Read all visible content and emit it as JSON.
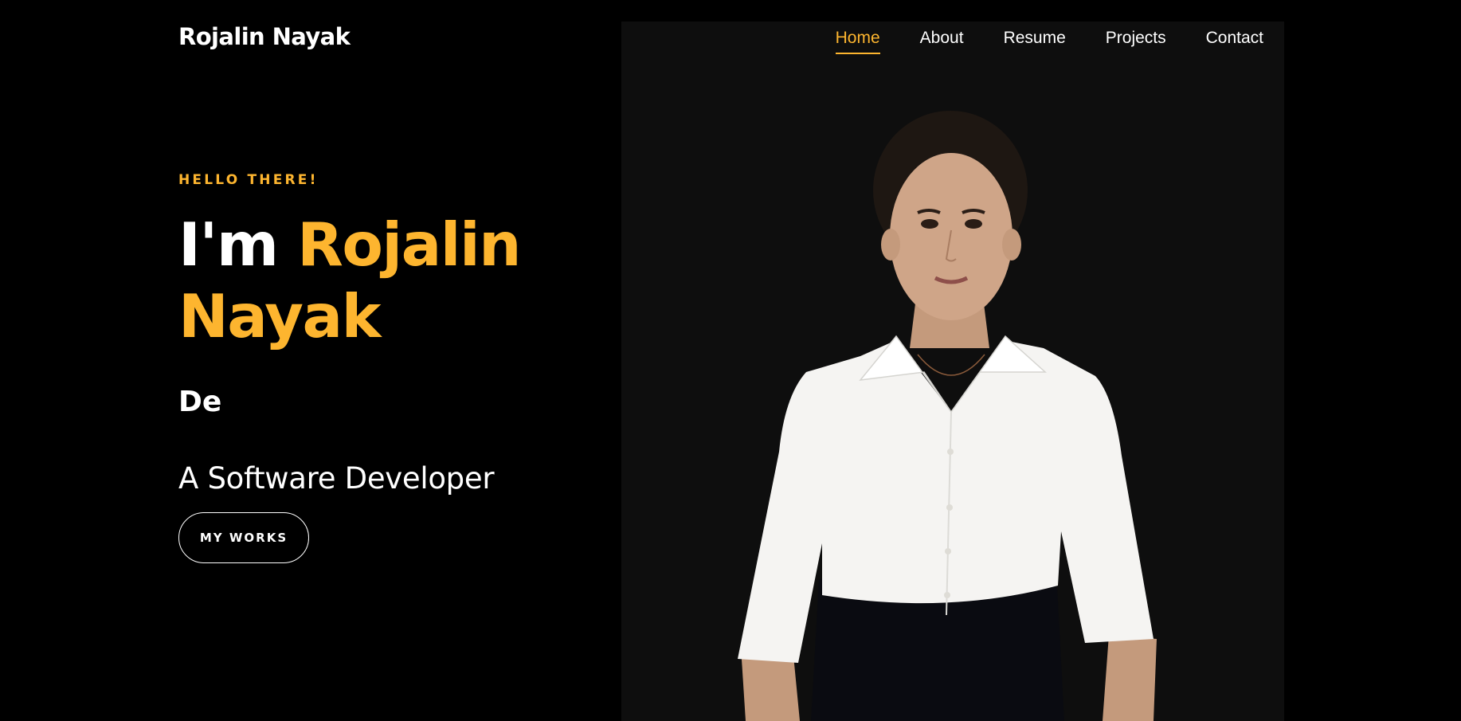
{
  "header": {
    "brand": "Rojalin Nayak",
    "nav": [
      {
        "label": "Home",
        "active": true
      },
      {
        "label": "About",
        "active": false
      },
      {
        "label": "Resume",
        "active": false
      },
      {
        "label": "Projects",
        "active": false
      },
      {
        "label": "Contact",
        "active": false
      }
    ]
  },
  "hero": {
    "greeting": "HELLO THERE!",
    "intro": "I'm",
    "first_name": "Rojalin",
    "last_name": "Nayak",
    "typed_text": "De",
    "role": "A Software Developer",
    "cta_label": "MY WORKS"
  },
  "colors": {
    "background": "#000000",
    "photo_panel": "#0e0e0e",
    "accent": "#fdb52f",
    "text": "#ffffff"
  },
  "image": {
    "subject": "portrait-photo"
  }
}
